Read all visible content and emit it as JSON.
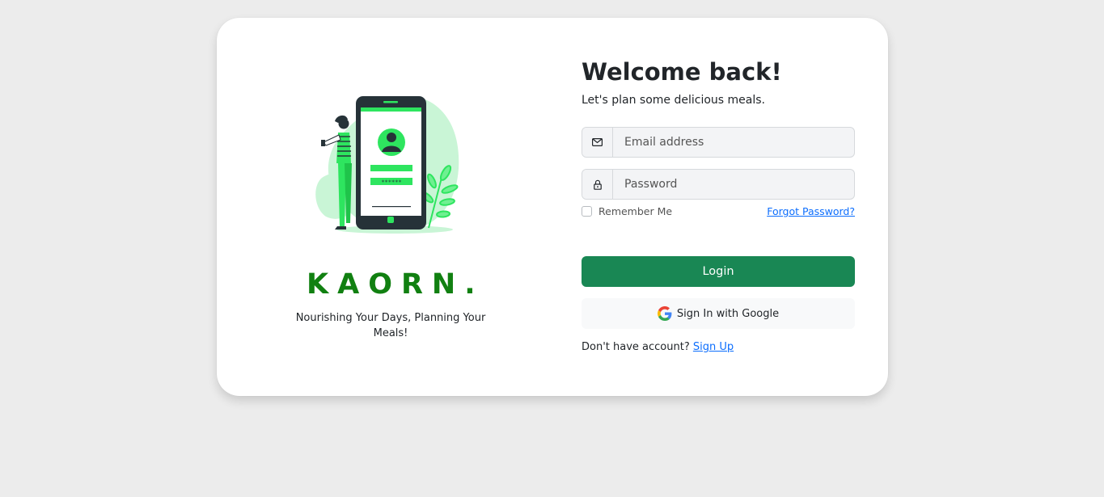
{
  "brand": {
    "name": "KAORN.",
    "tagline": "Nourishing Your Days, Planning Your Meals!"
  },
  "illustration": {
    "password_mask": "******"
  },
  "form": {
    "heading": "Welcome back!",
    "subheading": "Let's plan some delicious meals.",
    "email_placeholder": "Email address",
    "password_placeholder": "Password",
    "email_icon": "mail-icon",
    "password_icon": "lock-icon",
    "remember_label": "Remember Me",
    "forgot_label": "Forgot Password?",
    "login_label": "Login",
    "google_label": "Sign In with Google",
    "no_account_text": "Don't have account?",
    "signup_label": "Sign Up"
  },
  "colors": {
    "brand_green": "#118011",
    "login_green": "#198754",
    "link_blue": "#0d6efd",
    "illustration_green": "#2ee55f",
    "background": "#ececec"
  }
}
